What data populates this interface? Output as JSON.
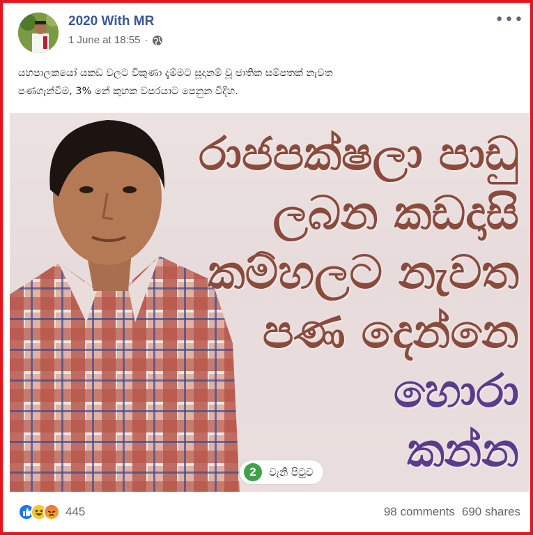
{
  "post": {
    "page_name": "2020 With MR",
    "timestamp": "1 June at 18:55",
    "separator": "·",
    "audience_icon": "globe-icon",
    "more_icon": "ellipsis-icon",
    "caption_line1": "යහපාලකයෝ යකඩ වලට විකුණා දැම්මට සූදානම් වූ ජාතික සම්පතක් නැවත",
    "caption_line2": "පණගැන්වීම, 3% නේ කුහක වපරයාට පෙනුන විදිහ."
  },
  "image": {
    "headline": [
      "රාජපක්ෂලා පාඩු",
      "ලබන කඩදාසි",
      "කම්හලට නැවත",
      "පණ දෙන්නෙ",
      "හොරා",
      "කන්න"
    ],
    "badge_number": "2",
    "badge_label": "වැනි පිටුව"
  },
  "engagement": {
    "reaction_icons": [
      "like-icon",
      "haha-icon",
      "angry-icon"
    ],
    "reaction_count": "445",
    "comments": "98 comments",
    "shares": "690 shares"
  },
  "colors": {
    "frame_border": "#e8141b",
    "page_name": "#385898",
    "headline_brown": "#8a4a3c",
    "headline_purple": "#5a3b8e",
    "badge_green": "#3fa24b"
  }
}
